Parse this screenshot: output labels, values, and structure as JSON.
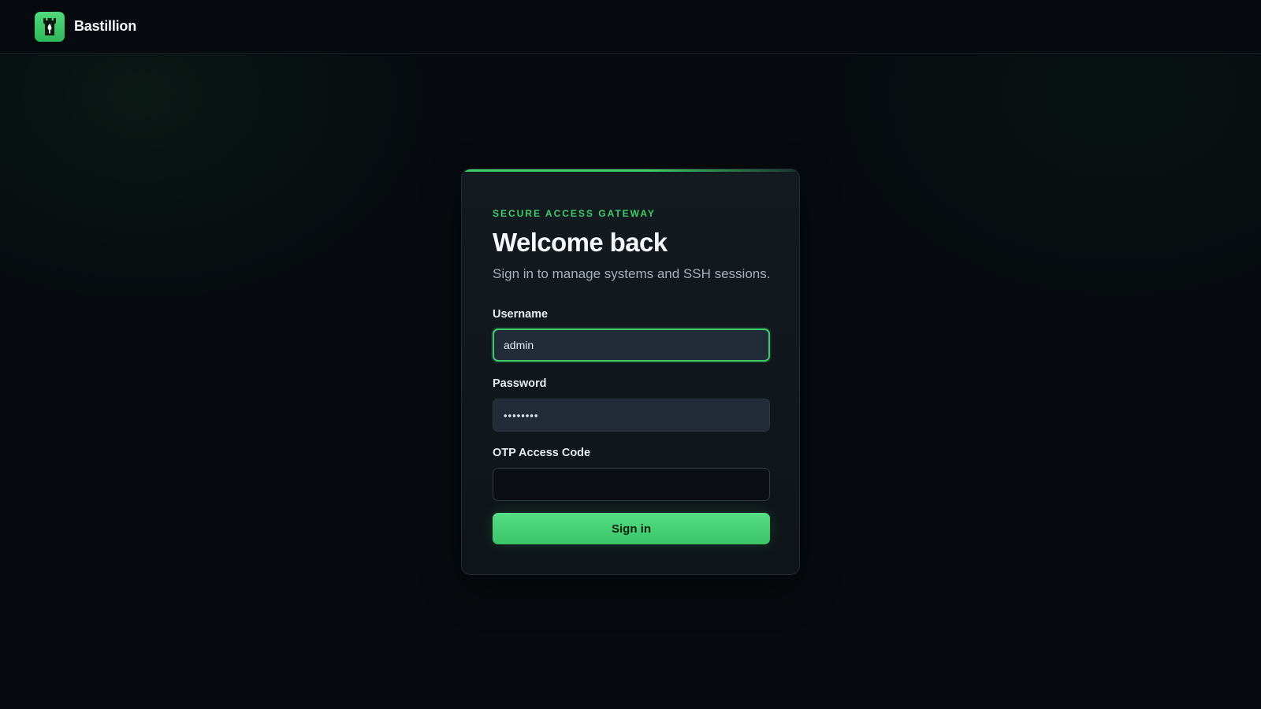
{
  "header": {
    "brand_name": "Bastillion",
    "logo_icon": "castle-tower-icon",
    "accent_color": "#3ecf6b"
  },
  "login": {
    "eyebrow": "SECURE ACCESS GATEWAY",
    "title": "Welcome back",
    "subtitle": "Sign in to manage systems and SSH sessions.",
    "username_label": "Username",
    "username_value": "admin",
    "password_label": "Password",
    "password_value": "password",
    "otp_label": "OTP Access Code",
    "otp_value": "",
    "submit_label": "Sign in"
  }
}
